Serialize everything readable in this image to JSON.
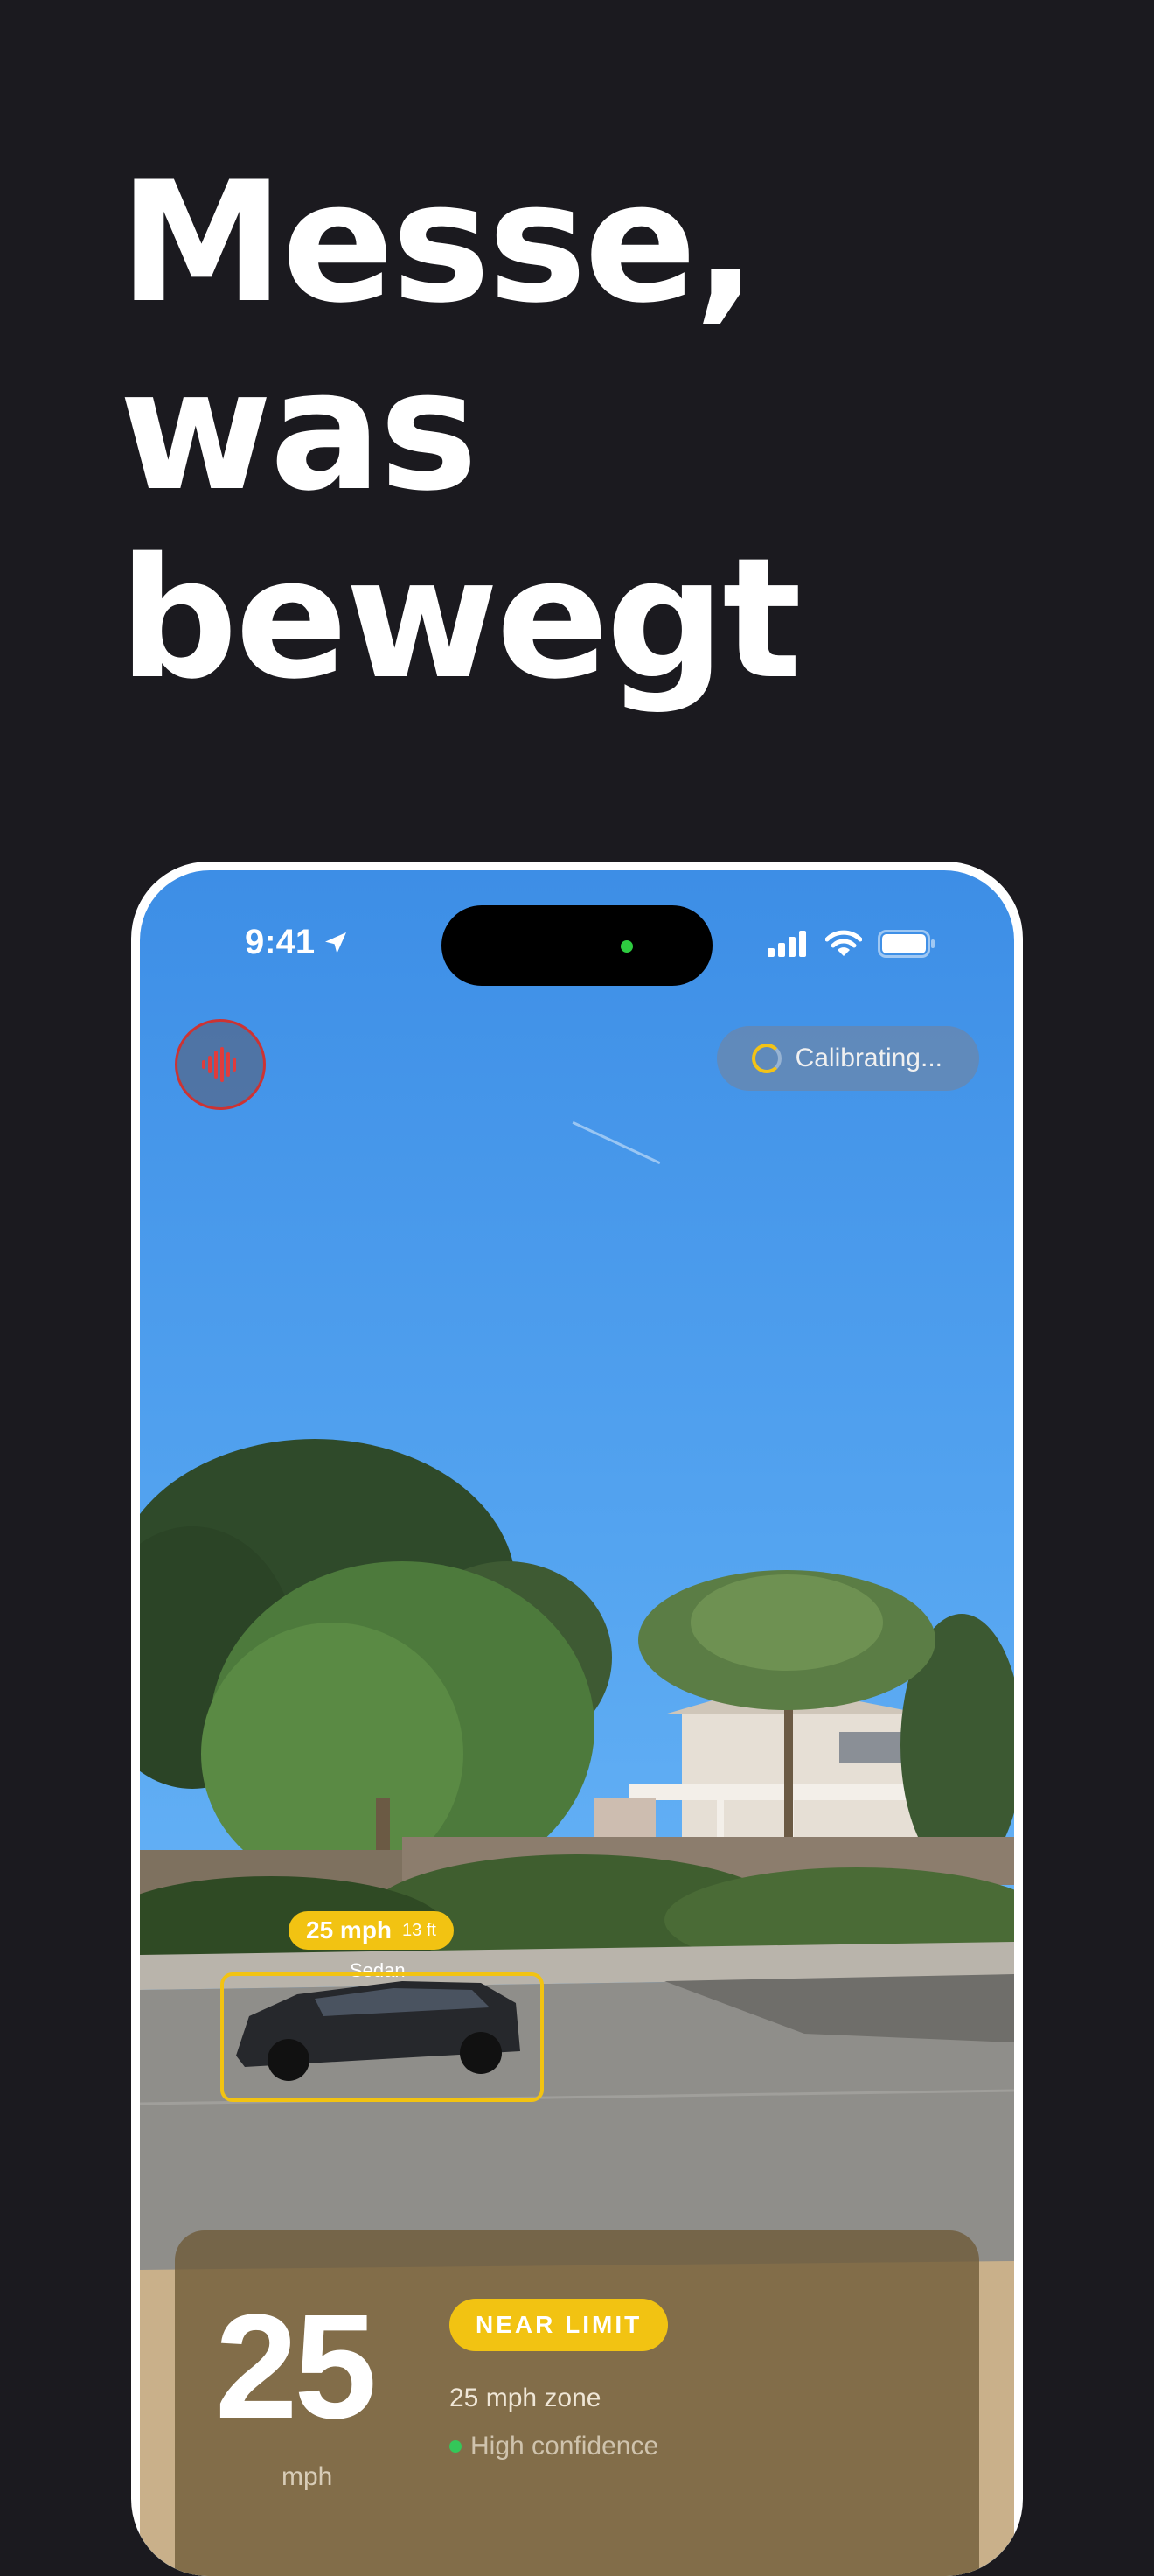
{
  "headline": {
    "line1": "Messe,",
    "line2": "was",
    "line3": "bewegt"
  },
  "status_bar": {
    "time": "9:41",
    "icons": [
      "location-arrow-icon",
      "cellular-signal-icon",
      "wifi-icon",
      "battery-icon"
    ]
  },
  "top_bar": {
    "mic_icon": "waveform-icon",
    "calibration_text": "Calibrating..."
  },
  "detection": {
    "speed": "25 mph",
    "distance": "13 ft",
    "class": "Sedan"
  },
  "speed_panel": {
    "value": "25",
    "unit": "mph",
    "badge": "NEAR LIMIT",
    "zone": "25 mph zone",
    "confidence": "High confidence"
  },
  "colors": {
    "accent": "#f2c312",
    "background": "#1b1a1f",
    "record": "#cc3333",
    "confidence": "#34c759"
  }
}
